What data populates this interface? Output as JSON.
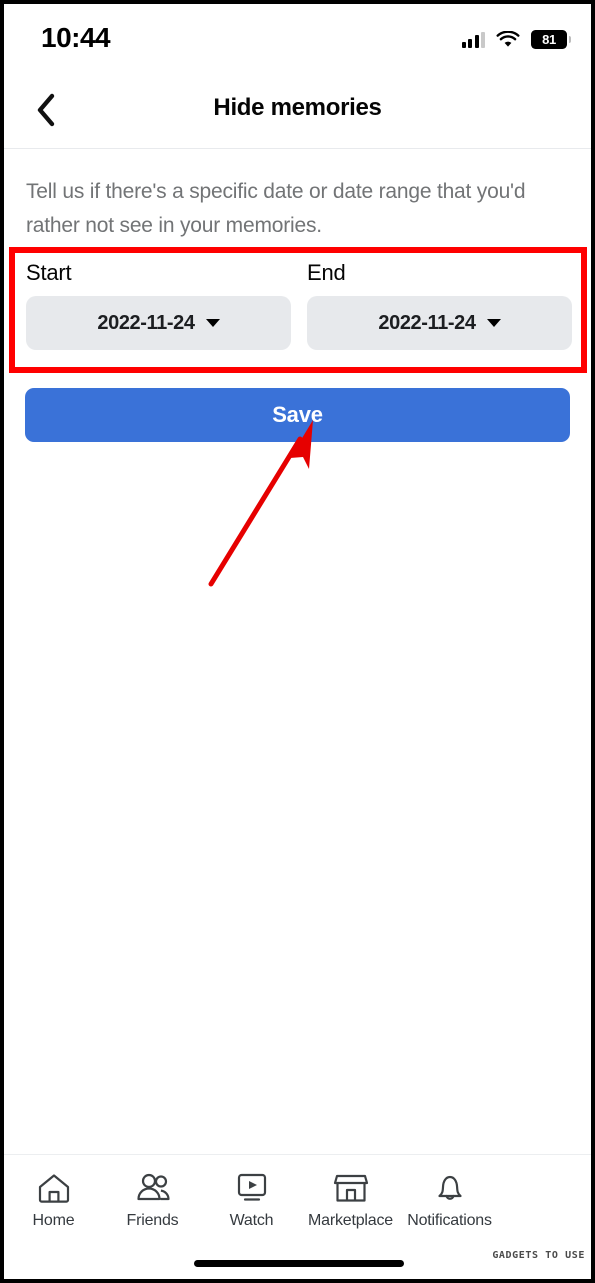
{
  "status_bar": {
    "time": "10:44",
    "battery_level": "81",
    "cellular_icon": "cellular-signal-icon",
    "wifi_icon": "wifi-icon",
    "battery_icon": "battery-icon"
  },
  "header": {
    "back_icon": "back-chevron-icon",
    "title": "Hide memories"
  },
  "main": {
    "description": "Tell us if there's a specific date or date range that you'd rather not see in your memories.",
    "start": {
      "label": "Start",
      "value": "2022-11-24",
      "caret_icon": "chevron-down-icon"
    },
    "end": {
      "label": "End",
      "value": "2022-11-24",
      "caret_icon": "chevron-down-icon"
    },
    "save_label": "Save"
  },
  "annotations": {
    "highlight_color": "#ff0000",
    "arrow_color": "#e60000"
  },
  "colors": {
    "save_button": "#3a72d8",
    "date_field_bg": "#e7e9ec",
    "description_text": "#727476",
    "accent_blue": "#4267b2"
  },
  "navbar": {
    "items": [
      {
        "label": "Home",
        "icon": "home-icon"
      },
      {
        "label": "Friends",
        "icon": "friends-icon"
      },
      {
        "label": "Watch",
        "icon": "watch-play-icon"
      },
      {
        "label": "Marketplace",
        "icon": "marketplace-storefront-icon"
      },
      {
        "label": "Notifications",
        "icon": "bell-icon"
      }
    ]
  },
  "watermark": {
    "text": "GADGETS TO USE"
  }
}
